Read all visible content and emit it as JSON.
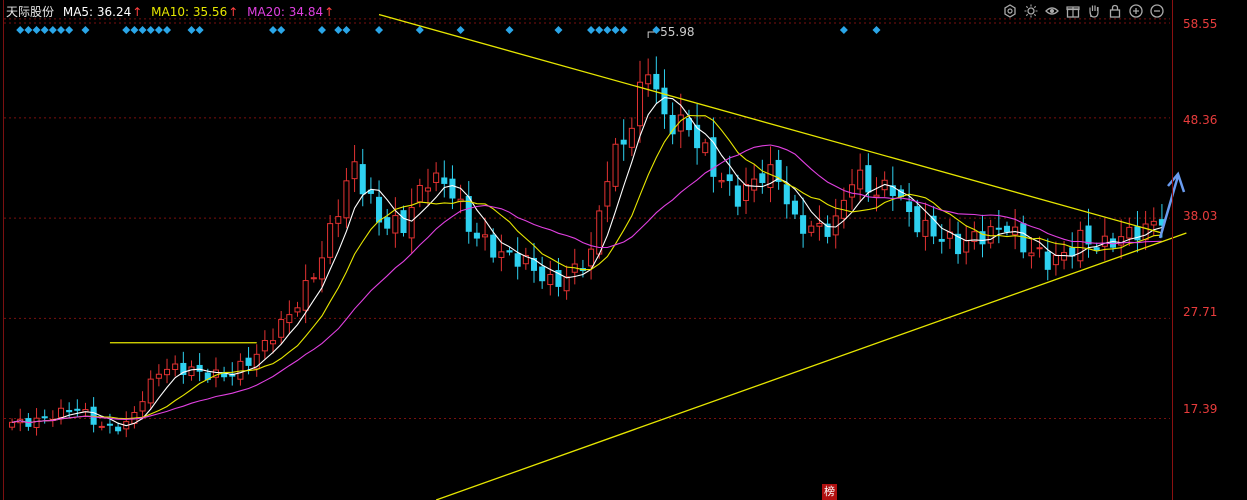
{
  "header": {
    "stock_name": "天际股份",
    "ma5_label": "MA5: 36.24",
    "ma10_label": "MA10: 35.56",
    "ma20_label": "MA20: 34.84",
    "arrow": "↑"
  },
  "toolbar": {
    "icons": [
      "gear-icon",
      "sun-icon",
      "eye-icon",
      "gift-icon",
      "hand-icon",
      "lock-icon",
      "zoom-in-icon",
      "zoom-out-icon"
    ]
  },
  "colors": {
    "up": "#e23232",
    "down": "#2ed1f0",
    "ma5": "#ffffff",
    "ma10": "#e6e600",
    "ma20": "#e040e0",
    "trendline": "#e6e600",
    "grid": "#7a1010",
    "signal": "#2aa6e8"
  },
  "price_axis": [
    "58.55",
    "48.36",
    "38.03",
    "27.71",
    "17.39"
  ],
  "peak_label": "55.98",
  "bottom_marker": "榜",
  "chart_data": {
    "type": "candlestick",
    "ylim": [
      9.0,
      60.5
    ],
    "num_candles": 142,
    "anchors": [
      [
        0,
        17.0
      ],
      [
        8,
        18.2
      ],
      [
        11,
        16.5
      ],
      [
        14,
        17.0
      ],
      [
        18,
        22.0
      ],
      [
        22,
        22.5
      ],
      [
        27,
        22.0
      ],
      [
        30,
        23.5
      ],
      [
        34,
        28.5
      ],
      [
        38,
        34.0
      ],
      [
        42,
        43.0
      ],
      [
        45,
        38.5
      ],
      [
        48,
        37.5
      ],
      [
        51,
        41.5
      ],
      [
        54,
        41.0
      ],
      [
        56,
        37.8
      ],
      [
        60,
        34.0
      ],
      [
        63,
        33.0
      ],
      [
        66,
        31.8
      ],
      [
        68,
        32.5
      ],
      [
        71,
        34.0
      ],
      [
        73,
        42.0
      ],
      [
        76,
        48.0
      ],
      [
        78,
        55.0
      ],
      [
        80,
        48.5
      ],
      [
        83,
        46.5
      ],
      [
        86,
        43.0
      ],
      [
        89,
        41.0
      ],
      [
        92,
        42.5
      ],
      [
        94,
        41.5
      ],
      [
        96,
        37.2
      ],
      [
        99,
        37.5
      ],
      [
        101,
        38.0
      ],
      [
        103,
        42.0
      ],
      [
        106,
        40.0
      ],
      [
        108,
        41.5
      ],
      [
        110,
        39.0
      ],
      [
        113,
        36.5
      ],
      [
        116,
        34.5
      ],
      [
        119,
        36.5
      ],
      [
        122,
        38.0
      ],
      [
        124,
        35.0
      ],
      [
        127,
        33.0
      ],
      [
        129,
        34.0
      ],
      [
        131,
        36.5
      ],
      [
        134,
        35.5
      ],
      [
        137,
        35.8
      ],
      [
        139,
        36.5
      ],
      [
        141,
        38.5
      ]
    ],
    "trendlines": [
      {
        "from": [
          45,
          59.0
        ],
        "to": [
          141,
          36.5
        ]
      },
      {
        "from": [
          52,
          9.0
        ],
        "to": [
          144,
          36.5
        ]
      },
      {
        "from": [
          12,
          25.2
        ],
        "to": [
          30,
          25.2
        ]
      }
    ]
  },
  "signals": {
    "row1": [
      1,
      2,
      3,
      4,
      5,
      6,
      7,
      9,
      14,
      15,
      16,
      17,
      18,
      19,
      22,
      23,
      32,
      33,
      38,
      40,
      41,
      45,
      50,
      55,
      61,
      67,
      71,
      72,
      73,
      74,
      75,
      79,
      102,
      106
    ]
  }
}
